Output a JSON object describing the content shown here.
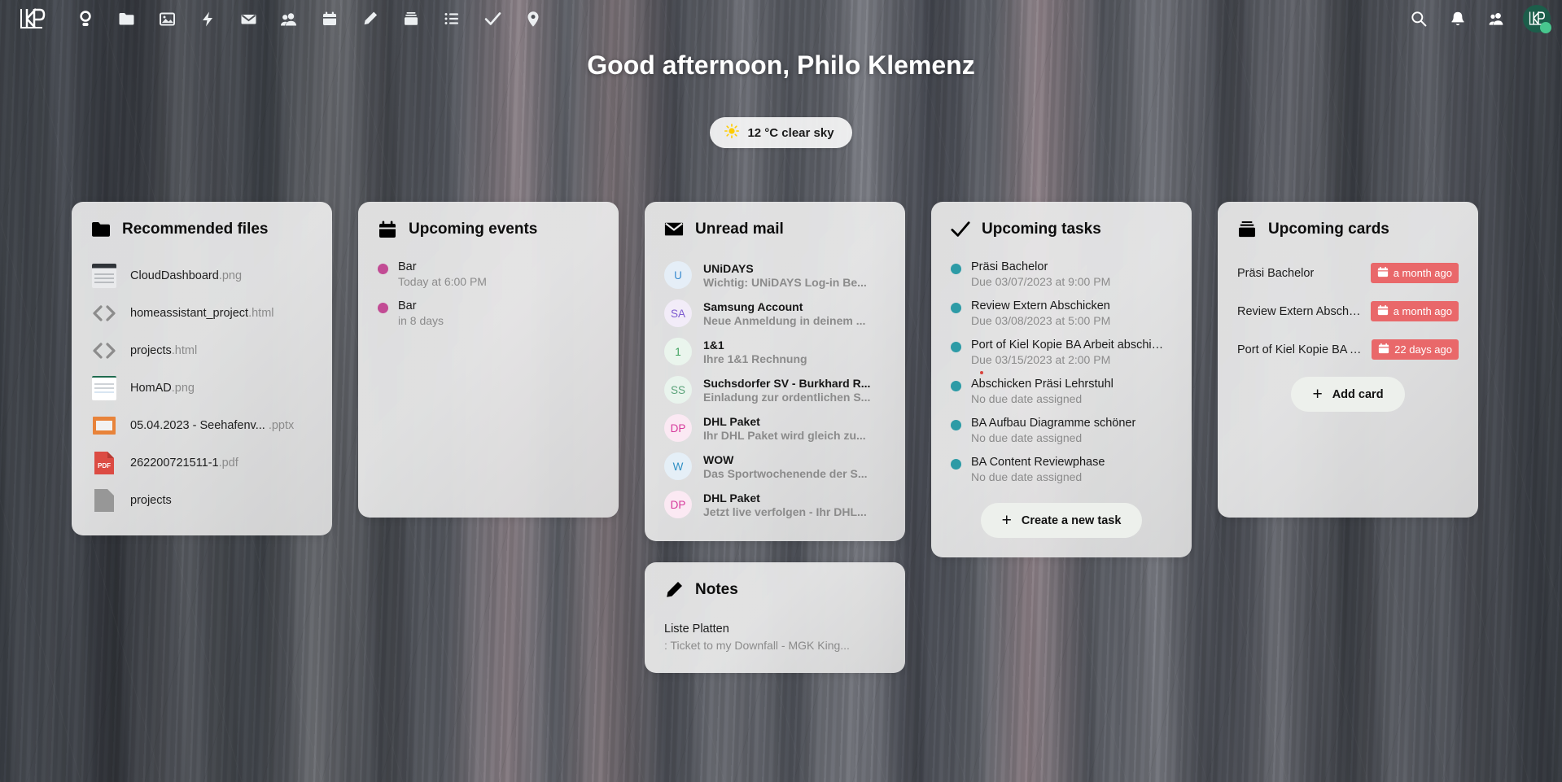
{
  "header": {
    "logo_alt": "LP logo",
    "nav_items": [
      {
        "name": "dashboard",
        "icon": "dashboard-icon"
      },
      {
        "name": "files",
        "icon": "folder-icon"
      },
      {
        "name": "photos",
        "icon": "photos-icon"
      },
      {
        "name": "activity",
        "icon": "activity-icon"
      },
      {
        "name": "mail",
        "icon": "mail-icon"
      },
      {
        "name": "contacts",
        "icon": "contacts-icon"
      },
      {
        "name": "calendar",
        "icon": "calendar-icon"
      },
      {
        "name": "notes",
        "icon": "pencil-icon"
      },
      {
        "name": "deck",
        "icon": "deck-icon"
      },
      {
        "name": "tasks",
        "icon": "list-icon"
      },
      {
        "name": "checks",
        "icon": "check-icon"
      },
      {
        "name": "maps",
        "icon": "location-icon"
      }
    ],
    "right_items": [
      {
        "name": "search",
        "icon": "search-icon"
      },
      {
        "name": "notifications",
        "icon": "bell-icon"
      },
      {
        "name": "contacts-menu",
        "icon": "person-icon"
      }
    ],
    "avatar_initials": "LP",
    "avatar_status": "online"
  },
  "greeting": {
    "text": "Good afternoon, Philo Klemenz",
    "weather": "12 °C clear sky",
    "weather_icon": "sun-icon"
  },
  "widgets": {
    "recommended_files": {
      "title": "Recommended files",
      "icon": "folder-icon",
      "items": [
        {
          "name": "CloudDashboard",
          "ext": ".png",
          "thumb": "image-preview-dark"
        },
        {
          "name": "homeassistant_project",
          "ext": ".html",
          "thumb": "code-icon"
        },
        {
          "name": "projects",
          "ext": ".html",
          "thumb": "code-icon"
        },
        {
          "name": "HomAD",
          "ext": ".png",
          "thumb": "image-preview-light"
        },
        {
          "name": "05.04.2023 - Seehafenv...",
          "ext": " .pptx",
          "thumb": "pptx-icon"
        },
        {
          "name": "262200721511-1",
          "ext": ".pdf",
          "thumb": "pdf-icon"
        },
        {
          "name": "projects",
          "ext": "",
          "thumb": "file-icon"
        }
      ]
    },
    "upcoming_events": {
      "title": "Upcoming events",
      "icon": "calendar-icon",
      "dot_color": "#c24b94",
      "items": [
        {
          "title": "Bar",
          "when": "Today at 6:00 PM"
        },
        {
          "title": "Bar",
          "when": "in 8 days"
        }
      ]
    },
    "unread_mail": {
      "title": "Unread mail",
      "icon": "mail-icon",
      "items": [
        {
          "initials": "U",
          "from": "UNiDAYS",
          "subject": "Wichtig: UNiDAYS Log-in Be...",
          "bg": "#e5eef7",
          "fg": "#3a8cd0"
        },
        {
          "initials": "SA",
          "from": "Samsung Account",
          "subject": "Neue Anmeldung in deinem ...",
          "bg": "#f2ecf8",
          "fg": "#7d5bd0"
        },
        {
          "initials": "1",
          "from": "1&1",
          "subject": "Ihre 1&1 Rechnung",
          "bg": "#eaf5ed",
          "fg": "#3fa25e"
        },
        {
          "initials": "SS",
          "from": "Suchsdorfer SV - Burkhard R...",
          "subject": "Einladung zur ordentlichen S...",
          "bg": "#e9f4ed",
          "fg": "#5ba37a"
        },
        {
          "initials": "DP",
          "from": "DHL Paket",
          "subject": "Ihr DHL Paket wird gleich zu...",
          "bg": "#fbe9f3",
          "fg": "#d6399b"
        },
        {
          "initials": "W",
          "from": "WOW",
          "subject": "Das Sportwochenende der S...",
          "bg": "#e5eff7",
          "fg": "#2f8fc4"
        },
        {
          "initials": "DP",
          "from": "DHL Paket",
          "subject": "Jetzt live verfolgen - Ihr DHL...",
          "bg": "#fbe9f3",
          "fg": "#d6399b"
        }
      ]
    },
    "upcoming_tasks": {
      "title": "Upcoming tasks",
      "icon": "check-icon",
      "dot_color": "#2d9ba6",
      "button_label": "Create a new task",
      "items": [
        {
          "title": "Präsi Bachelor",
          "due": "Due 03/07/2023 at 9:00 PM",
          "flag": false
        },
        {
          "title": "Review Extern Abschicken",
          "due": "Due 03/08/2023 at 5:00 PM",
          "flag": false
        },
        {
          "title": "Port of Kiel Kopie BA Arbeit abschic...",
          "due": "Due 03/15/2023 at 2:00 PM",
          "flag": false
        },
        {
          "title": "Abschicken Präsi Lehrstuhl",
          "due": "No due date assigned",
          "flag": true
        },
        {
          "title": "BA Aufbau Diagramme schöner",
          "due": "No due date assigned",
          "flag": false
        },
        {
          "title": "BA Content Reviewphase",
          "due": "No due date assigned",
          "flag": false
        }
      ]
    },
    "upcoming_cards": {
      "title": "Upcoming cards",
      "icon": "deck-icon",
      "badge_color": "#e9686a",
      "button_label": "Add card",
      "items": [
        {
          "title": "Präsi Bachelor",
          "due": "a month ago"
        },
        {
          "title": "Review Extern Abschic...",
          "due": "a month ago"
        },
        {
          "title": "Port of Kiel Kopie BA A...",
          "due": "22 days ago"
        }
      ]
    },
    "notes": {
      "title": "Notes",
      "icon": "pencil-icon",
      "items": [
        {
          "title": "Liste Platten",
          "preview": ":   Ticket to my Downfall - MGK   King..."
        }
      ]
    }
  }
}
